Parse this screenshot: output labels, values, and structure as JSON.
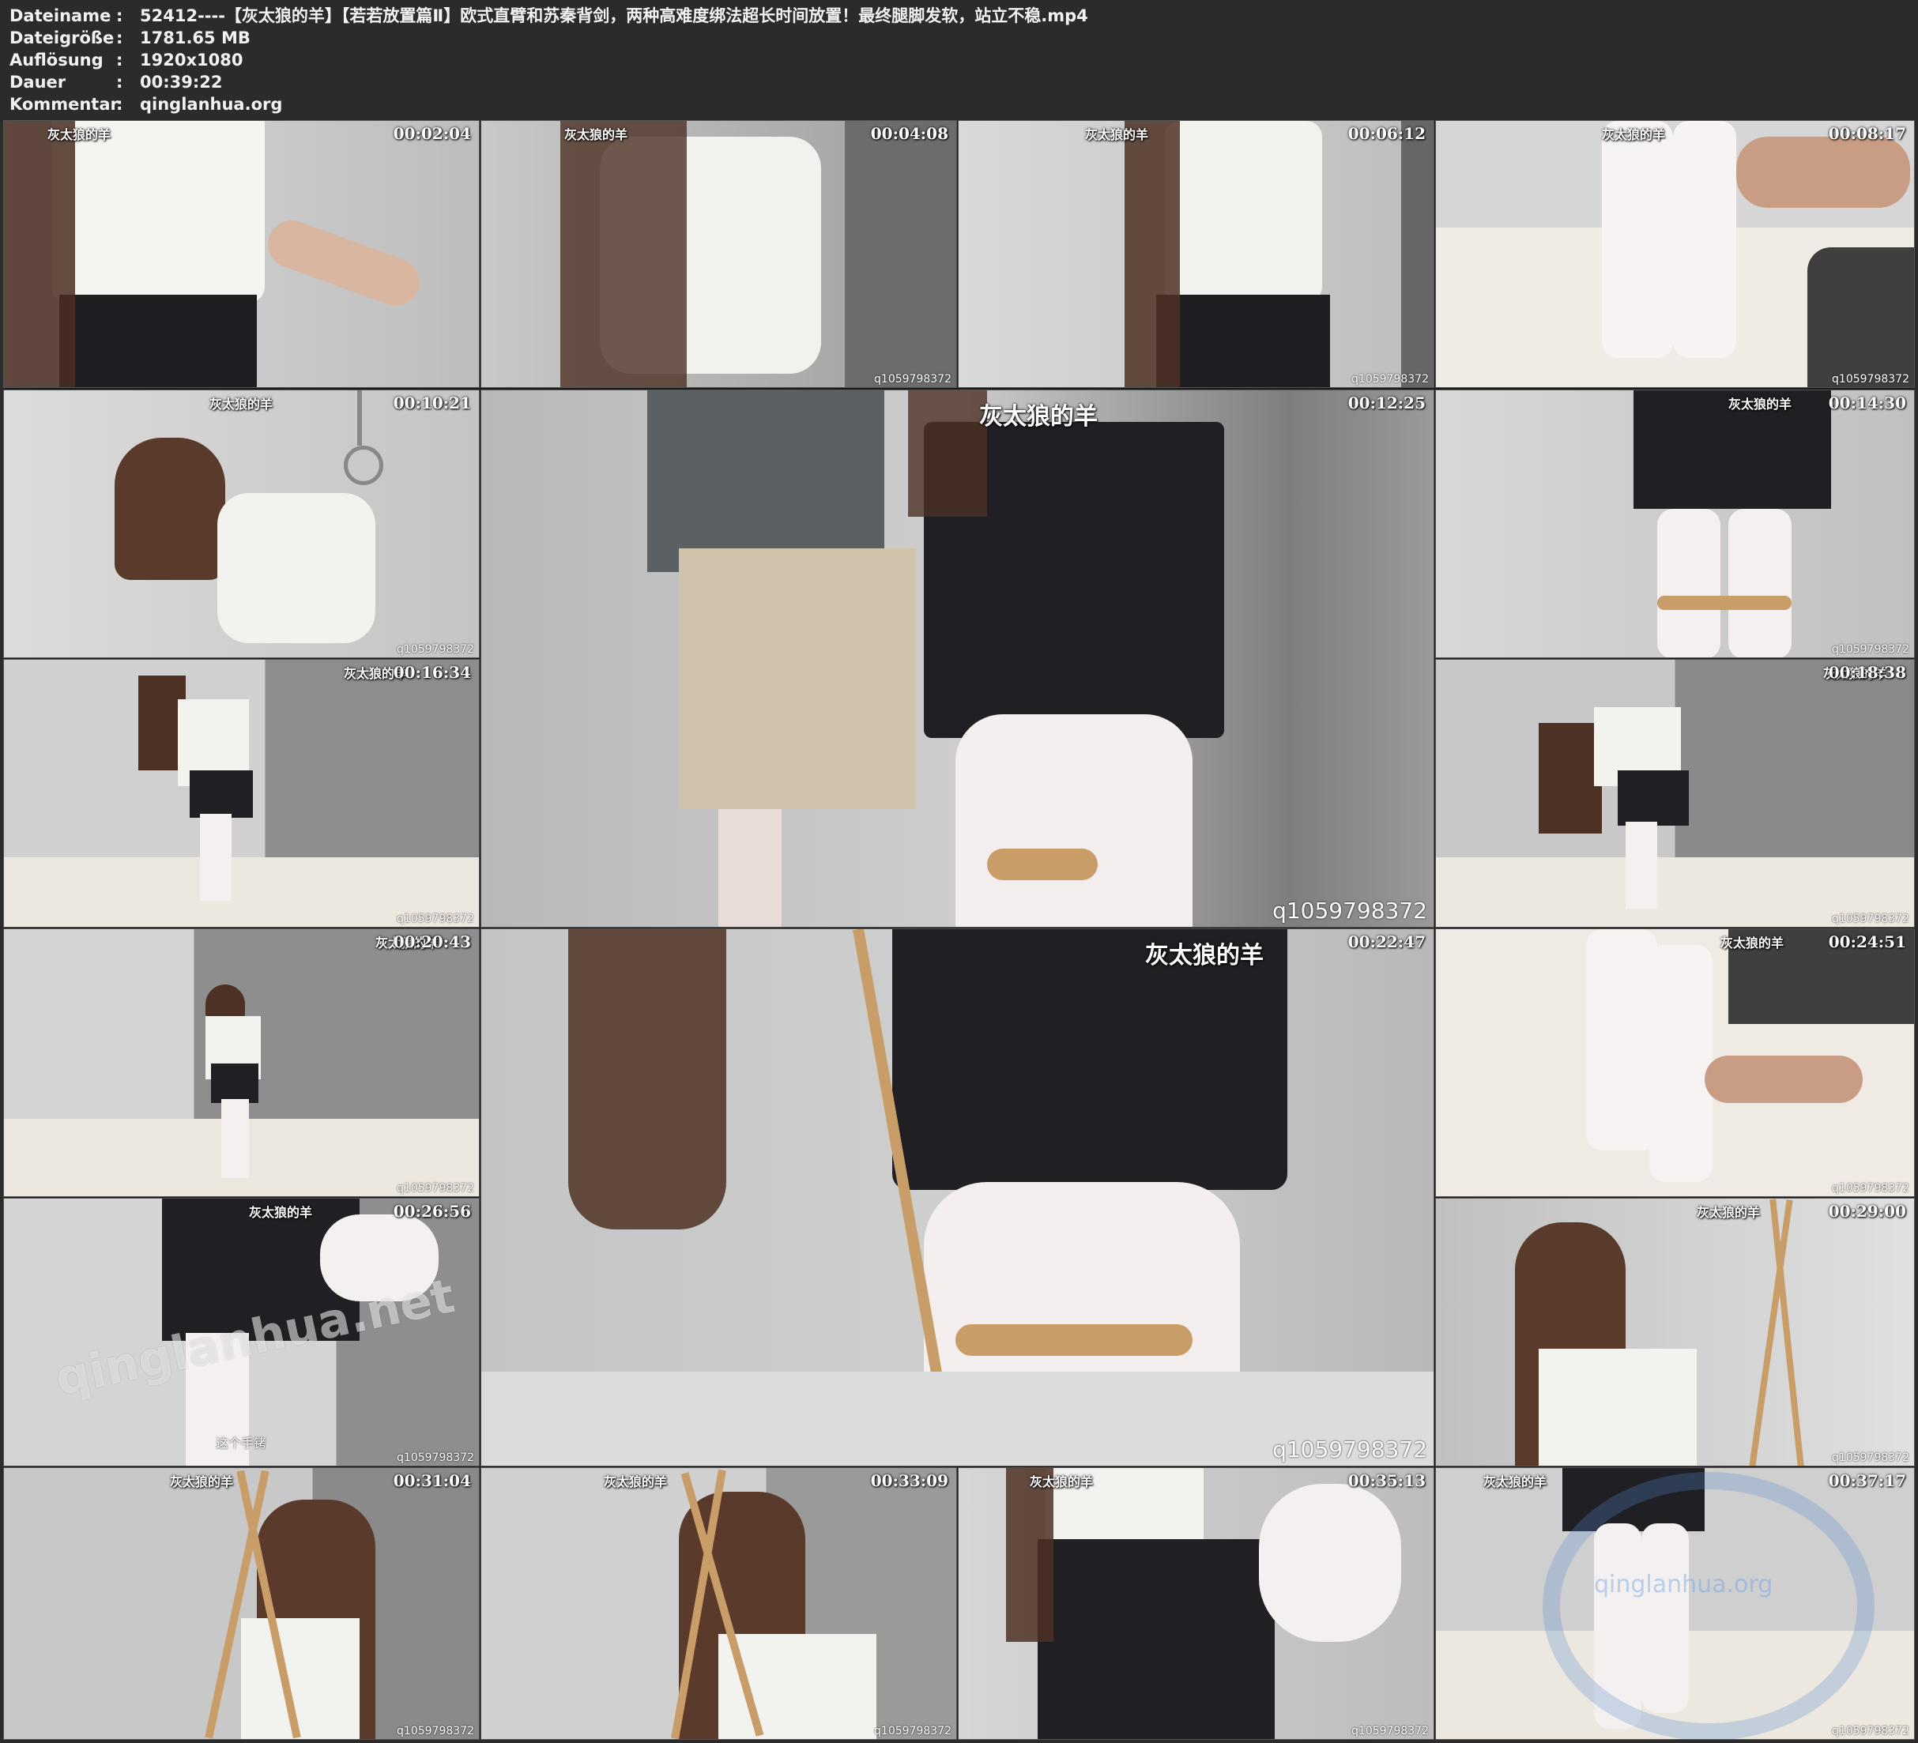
{
  "meta": {
    "filename_label": "Dateiname",
    "filename_value": "52412----【灰太狼的羊】【若若放置篇Ⅱ】欧式直臂和苏秦背剑，两种高难度绑法超长时间放置！最终腿脚发软，站立不稳.mp4",
    "size_label": "Dateigröße",
    "size_value": "1781.65 MB",
    "resolution_label": "Auflösung",
    "resolution_value": "1920x1080",
    "duration_label": "Dauer",
    "duration_value": "00:39:22",
    "comment_label": "Kommentar",
    "comment_value": "qinglanhua.org",
    "colon": ":"
  },
  "thumb_watermark": "q1059798372",
  "logo_text": "灰太狼的羊",
  "thumbs": [
    {
      "time": "00:02:04"
    },
    {
      "time": "00:04:08"
    },
    {
      "time": "00:06:12"
    },
    {
      "time": "00:08:17"
    },
    {
      "time": "00:10:21"
    },
    {
      "time": "00:12:25"
    },
    {
      "time": "00:14:30"
    },
    {
      "time": "00:16:34"
    },
    {
      "time": "00:18:38"
    },
    {
      "time": "00:20:43"
    },
    {
      "time": "00:22:47"
    },
    {
      "time": "00:24:51"
    },
    {
      "time": "00:26:56"
    },
    {
      "time": "00:29:00"
    },
    {
      "time": "00:31:04"
    },
    {
      "time": "00:33:09"
    },
    {
      "time": "00:35:13"
    },
    {
      "time": "00:37:17"
    }
  ],
  "caption_26": "这个手铐",
  "site_watermark": "qinglanhua.net",
  "circle_watermark": "qinglanhua.org"
}
